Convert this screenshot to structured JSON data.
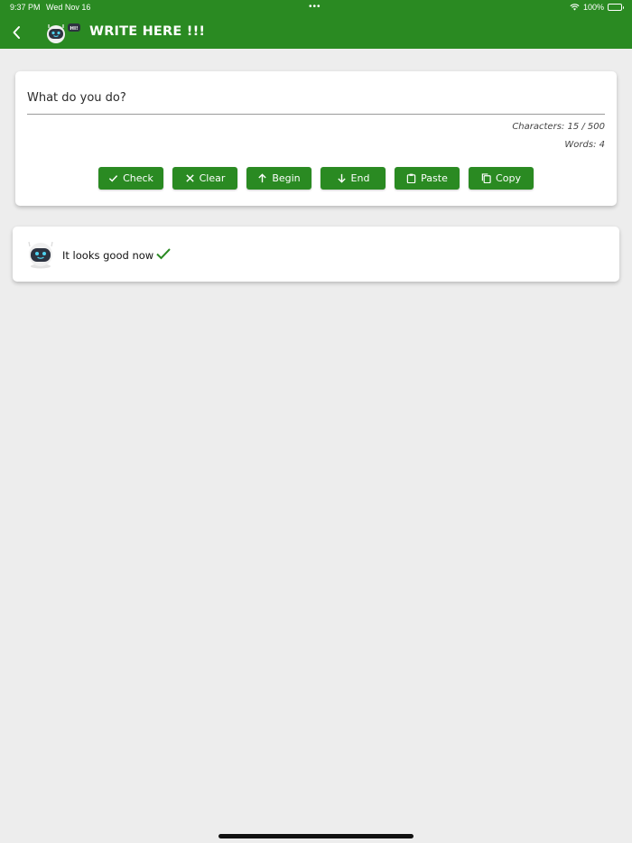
{
  "status_bar": {
    "time": "9:37 PM",
    "date": "Wed Nov 16",
    "dots": "•••",
    "battery": "100%"
  },
  "navbar": {
    "title": "WRITE HERE !!!",
    "logo_badge": "HI!",
    "back_icon": "chevron-left-icon"
  },
  "editor": {
    "text": "What do you do?",
    "characters": "Characters: 15 / 500",
    "words": "Words: 4"
  },
  "buttons": [
    {
      "label": "Check",
      "icon": "check-icon"
    },
    {
      "label": "Clear",
      "icon": "close-icon"
    },
    {
      "label": "Begin",
      "icon": "arrow-up-icon"
    },
    {
      "label": "End",
      "icon": "arrow-down-icon"
    },
    {
      "label": "Paste",
      "icon": "clipboard-icon"
    },
    {
      "label": "Copy",
      "icon": "copy-icon"
    }
  ],
  "result": {
    "message": "It looks good now",
    "icon": "check-icon"
  },
  "colors": {
    "accent": "#2a8a22",
    "background": "#ededed",
    "card": "#ffffff"
  }
}
